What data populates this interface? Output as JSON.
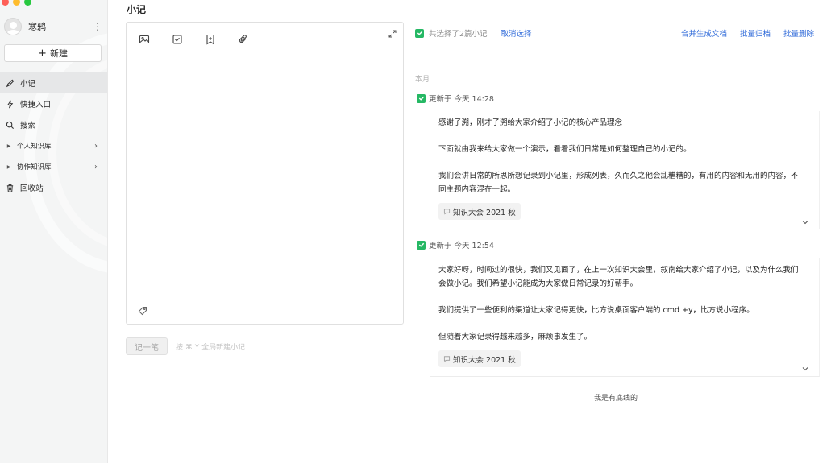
{
  "sidebar": {
    "username": "寒鸦",
    "new_button": "新建",
    "nav": [
      {
        "label": "小记",
        "icon": "pen-icon"
      },
      {
        "label": "快捷入口",
        "icon": "lightning-icon"
      },
      {
        "label": "搜索",
        "icon": "search-icon"
      },
      {
        "label": "个人知识库",
        "icon": "caret-right-icon"
      },
      {
        "label": "协作知识库",
        "icon": "caret-right-icon"
      },
      {
        "label": "回收站",
        "icon": "trash-icon"
      }
    ]
  },
  "page": {
    "title": "小记"
  },
  "editor": {
    "save_button": "记一笔",
    "shortcut_hint": "按 ⌘ Y 全局新建小记",
    "tools": [
      "image-icon",
      "checkbox-icon",
      "bookmark-icon",
      "attachment-icon"
    ]
  },
  "selection": {
    "status": "共选择了2篇小记",
    "cancel": "取消选择",
    "actions": [
      "合并生成文档",
      "批量归档",
      "批量删除"
    ]
  },
  "list": {
    "month_label": "本月",
    "notes": [
      {
        "updated": "更新于 今天 14:28",
        "paragraphs": [
          "感谢子溯，刚才子溯给大家介绍了小记的核心产品理念",
          "下面就由我来给大家做一个演示，看看我们日常是如何整理自己的小记的。",
          "我们会讲日常的所思所想记录到小记里，形成列表，久而久之他会乱糟糟的，有用的内容和无用的内容，不同主题内容混在一起。"
        ],
        "tag": "知识大会 2021 秋"
      },
      {
        "updated": "更新于 今天 12:54",
        "paragraphs": [
          "大家好呀，时间过的很快，我们又见面了，在上一次知识大会里，叙南给大家介绍了小记，以及为什么我们会做小记。我们希望小记能成为大家做日常记录的好帮手。",
          "我们提供了一些便利的渠道让大家记得更快，比方说桌面客户端的 cmd +y，比方说小程序。",
          "但随着大家记录得越来越多，麻烦事发生了。"
        ],
        "tag": "知识大会 2021 秋"
      }
    ],
    "end_text": "我是有底线的"
  },
  "colors": {
    "accent": "#2f6ad9",
    "check": "#25b864"
  }
}
